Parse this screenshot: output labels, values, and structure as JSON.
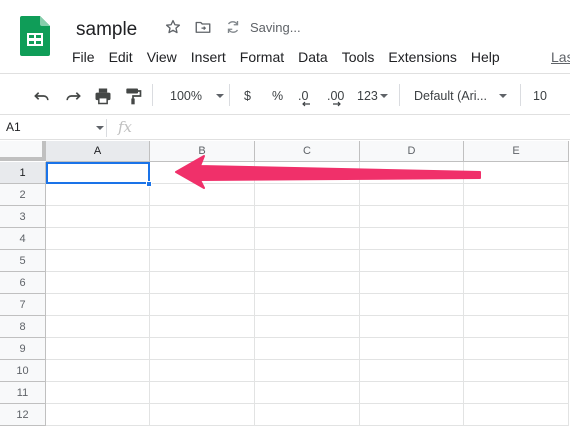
{
  "app": {
    "doc_title": "sample",
    "saving_status": "Saving...",
    "brand_green": "#0f9d58",
    "icons": [
      "sheets-logo-icon",
      "star-icon",
      "move-to-folder-icon",
      "sync-icon"
    ]
  },
  "menu": {
    "items": [
      "File",
      "Edit",
      "View",
      "Insert",
      "Format",
      "Data",
      "Tools",
      "Extensions",
      "Help"
    ],
    "last_edit": "Last"
  },
  "toolbar": {
    "zoom": "100%",
    "currency": "$",
    "percent": "%",
    "decrease_decimal": ".0",
    "increase_decimal": ".00",
    "more_formats": "123",
    "font": "Default (Ari...",
    "font_size": "10",
    "icons": [
      "undo-icon",
      "redo-icon",
      "print-icon",
      "paint-format-icon"
    ]
  },
  "formula_bar": {
    "cell_ref": "A1",
    "fx": "fx",
    "value": ""
  },
  "grid": {
    "columns": [
      "A",
      "B",
      "C",
      "D",
      "E"
    ],
    "rows": [
      "1",
      "2",
      "3",
      "4",
      "5",
      "6",
      "7",
      "8",
      "9",
      "10",
      "11",
      "12"
    ],
    "selected_cell": "A1",
    "selection_color": "#1a73e8"
  },
  "annotation": {
    "arrow_color": "#f0306a",
    "points_to": "A1"
  }
}
